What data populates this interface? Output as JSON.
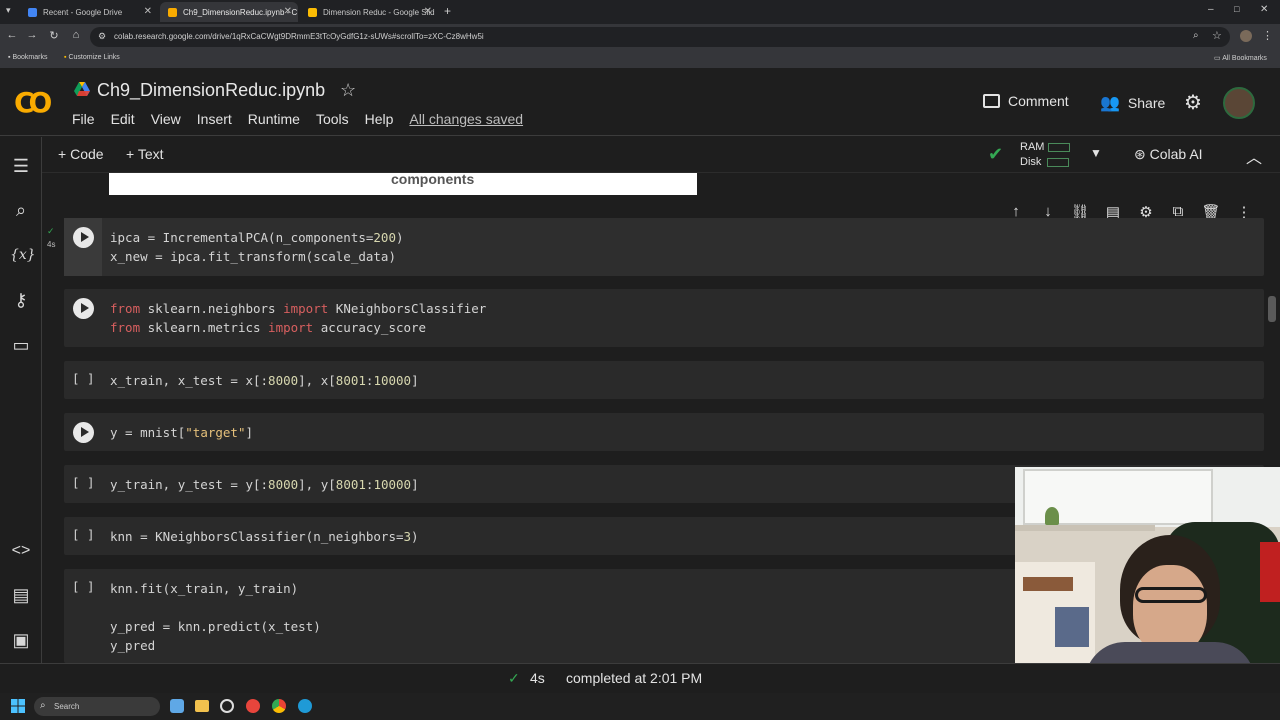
{
  "browser": {
    "tabs": [
      {
        "label": "Recent - Google Drive",
        "active": false
      },
      {
        "label": "Ch9_DimensionReduc.ipynb - C",
        "active": true
      },
      {
        "label": "Dimension Reduc - Google Slid",
        "active": false
      }
    ],
    "url": "colab.research.google.com/drive/1qRxCaCWgt9DRmmE3tTcOyGdfG1z-sUWs#scrollTo=zXC-Cz8wHw5i",
    "bookmarks": [
      "Bookmarks",
      "Customize Links"
    ],
    "all_bookmarks": "All Bookmarks"
  },
  "colab": {
    "logo": "CO",
    "title": "Ch9_DimensionReduc.ipynb",
    "menu": [
      "File",
      "Edit",
      "View",
      "Insert",
      "Runtime",
      "Tools",
      "Help"
    ],
    "saved": "All changes saved",
    "comment": "Comment",
    "share": "Share"
  },
  "toolbar": {
    "add_code": "Code",
    "add_text": "Text",
    "ram": "RAM",
    "disk": "Disk",
    "colab_ai": "Colab AI"
  },
  "prev_output": "components",
  "cells": {
    "c1": {
      "time": "4s"
    },
    "empty_bracket": "[ ]"
  },
  "status": {
    "time": "4s",
    "message": "completed at 2:01 PM"
  },
  "taskbar": {
    "search": "Search"
  },
  "colors": {
    "accent_orange": "#f9ab00",
    "success_green": "#34a853",
    "keyword": "#d75f5f",
    "string": "#e5c07b"
  }
}
